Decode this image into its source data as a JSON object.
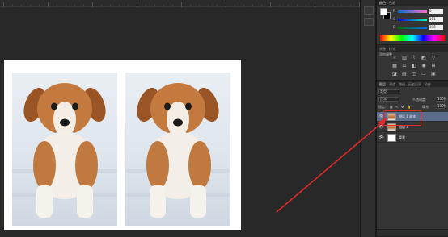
{
  "color_panel": {
    "tabs": [
      "颜色",
      "色板"
    ],
    "channels": [
      {
        "label": "R",
        "value": "0"
      },
      {
        "label": "G",
        "value": "111"
      },
      {
        "label": "B",
        "value": "198"
      }
    ],
    "foreground": "#ffffff",
    "background": "#000000"
  },
  "styles_panel": {
    "tabs": [
      "调整",
      "样式"
    ],
    "title": "添加调整"
  },
  "layers_panel": {
    "tabs": [
      "图层",
      "通道",
      "路径",
      "历史记录",
      "动作"
    ],
    "kind_filter": "类型",
    "blend_mode": "正常",
    "opacity_label": "不透明度:",
    "opacity_value": "100%",
    "lock_label": "锁定:",
    "fill_label": "填充:",
    "fill_value": "100%",
    "layers": [
      {
        "name": "图层 1 副本",
        "selected": true,
        "thumb": "dog"
      },
      {
        "name": "图层 1",
        "selected": false,
        "thumb": "dog"
      },
      {
        "name": "背景",
        "selected": false,
        "thumb": "white"
      }
    ]
  },
  "colors": {
    "annotation": "#e02a2a",
    "selection": "#5a6e8c"
  }
}
